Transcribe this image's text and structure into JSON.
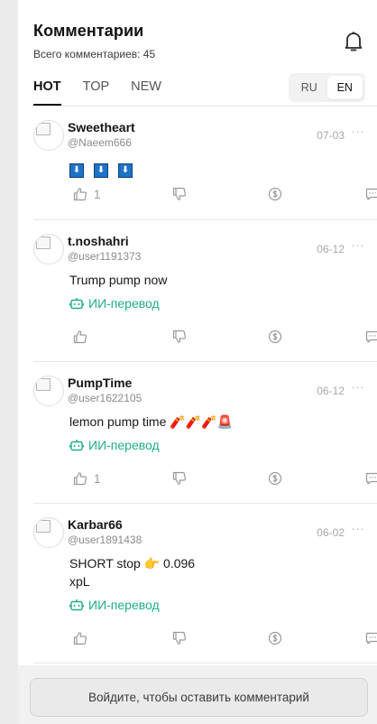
{
  "header": {
    "title": "Комментарии",
    "subtitle": "Всего комментариев: 45"
  },
  "tabs": [
    {
      "label": "HOT",
      "active": true
    },
    {
      "label": "TOP",
      "active": false
    },
    {
      "label": "NEW",
      "active": false
    }
  ],
  "language": {
    "options": [
      "RU",
      "EN"
    ],
    "selected": "EN"
  },
  "translate_label": "ИИ-перевод",
  "comments": [
    {
      "username": "Sweetheart",
      "handle": "@Naeem666",
      "date": "07-03",
      "text": "⬇️ ⬇️ ⬇️",
      "likes": "1",
      "has_translate": false
    },
    {
      "username": "t.noshahri",
      "handle": "@user1191373",
      "date": "06-12",
      "text": "Trump pump now",
      "likes": "",
      "has_translate": true
    },
    {
      "username": "PumpTime",
      "handle": "@user1622105",
      "date": "06-12",
      "text": "lemon pump time 🧨🧨🧨🚨",
      "likes": "1",
      "has_translate": true
    },
    {
      "username": "Karbar66",
      "handle": "@user1891438",
      "date": "06-02",
      "text_line1": "SHORT stop 👉 0.096",
      "text_line2": "xpL",
      "likes": "",
      "has_translate": true
    }
  ],
  "footer": {
    "login_button": "Войдите, чтобы оставить комментарий"
  },
  "colors": {
    "accent_green": "#1fae87",
    "text_primary": "#121212",
    "text_muted": "#8a8a8a"
  }
}
